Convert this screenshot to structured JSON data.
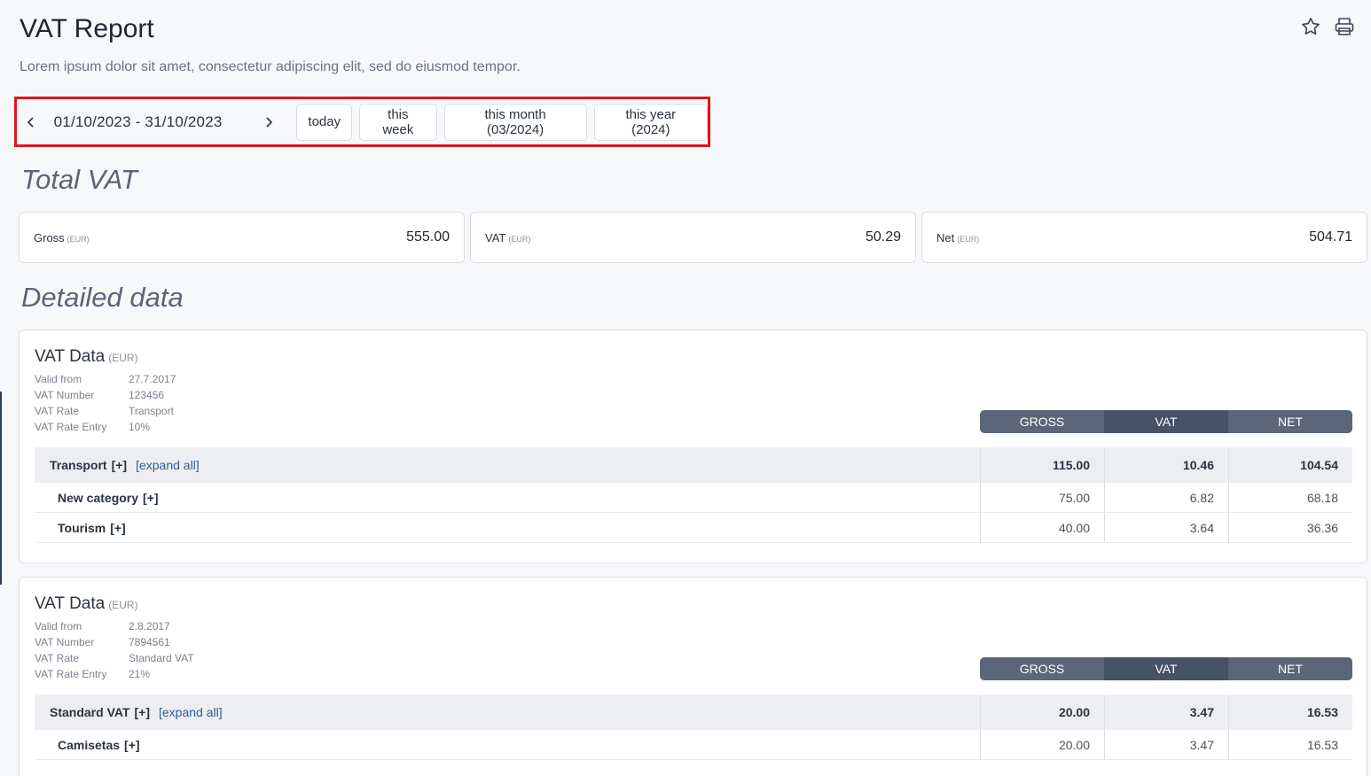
{
  "header": {
    "title": "VAT Report",
    "subtitle": "Lorem ipsum dolor sit amet, consectetur adipiscing elit, sed do eiusmod tempor.",
    "icons": [
      "star-icon",
      "printer-icon"
    ]
  },
  "datebar": {
    "range": "01/10/2023 - 31/10/2023",
    "buttons": [
      "today",
      "this week",
      "this month (03/2024)",
      "this year (2024)"
    ]
  },
  "sections": {
    "total": "Total VAT",
    "detailed": "Detailed data"
  },
  "totals": [
    {
      "label": "Gross",
      "unit": "(EUR)",
      "value": "555.00"
    },
    {
      "label": "VAT",
      "unit": "(EUR)",
      "value": "50.29"
    },
    {
      "label": "Net",
      "unit": "(EUR)",
      "value": "504.71"
    }
  ],
  "columns": [
    "GROSS",
    "VAT",
    "NET"
  ],
  "vat_groups": [
    {
      "title": "VAT Data",
      "unit": "(EUR)",
      "meta": [
        {
          "key": "Valid from",
          "value": "27.7.2017"
        },
        {
          "key": "VAT Number",
          "value": "123456"
        },
        {
          "key": "VAT Rate",
          "value": "Transport"
        },
        {
          "key": "VAT Rate Entry",
          "value": "10%"
        }
      ],
      "main": {
        "name": "Transport",
        "plus": "[+]",
        "expand": "[expand all]",
        "gross": "115.00",
        "vat": "10.46",
        "net": "104.54"
      },
      "rows": [
        {
          "name": "New category",
          "plus": "[+]",
          "gross": "75.00",
          "vat": "6.82",
          "net": "68.18"
        },
        {
          "name": "Tourism",
          "plus": "[+]",
          "gross": "40.00",
          "vat": "3.64",
          "net": "36.36"
        }
      ]
    },
    {
      "title": "VAT Data",
      "unit": "(EUR)",
      "meta": [
        {
          "key": "Valid from",
          "value": "2.8.2017"
        },
        {
          "key": "VAT Number",
          "value": "7894561"
        },
        {
          "key": "VAT Rate",
          "value": "Standard VAT"
        },
        {
          "key": "VAT Rate Entry",
          "value": "21%"
        }
      ],
      "main": {
        "name": "Standard VAT",
        "plus": "[+]",
        "expand": "[expand all]",
        "gross": "20.00",
        "vat": "3.47",
        "net": "16.53"
      },
      "rows": [
        {
          "name": "Camisetas",
          "plus": "[+]",
          "gross": "20.00",
          "vat": "3.47",
          "net": "16.53"
        }
      ]
    }
  ]
}
